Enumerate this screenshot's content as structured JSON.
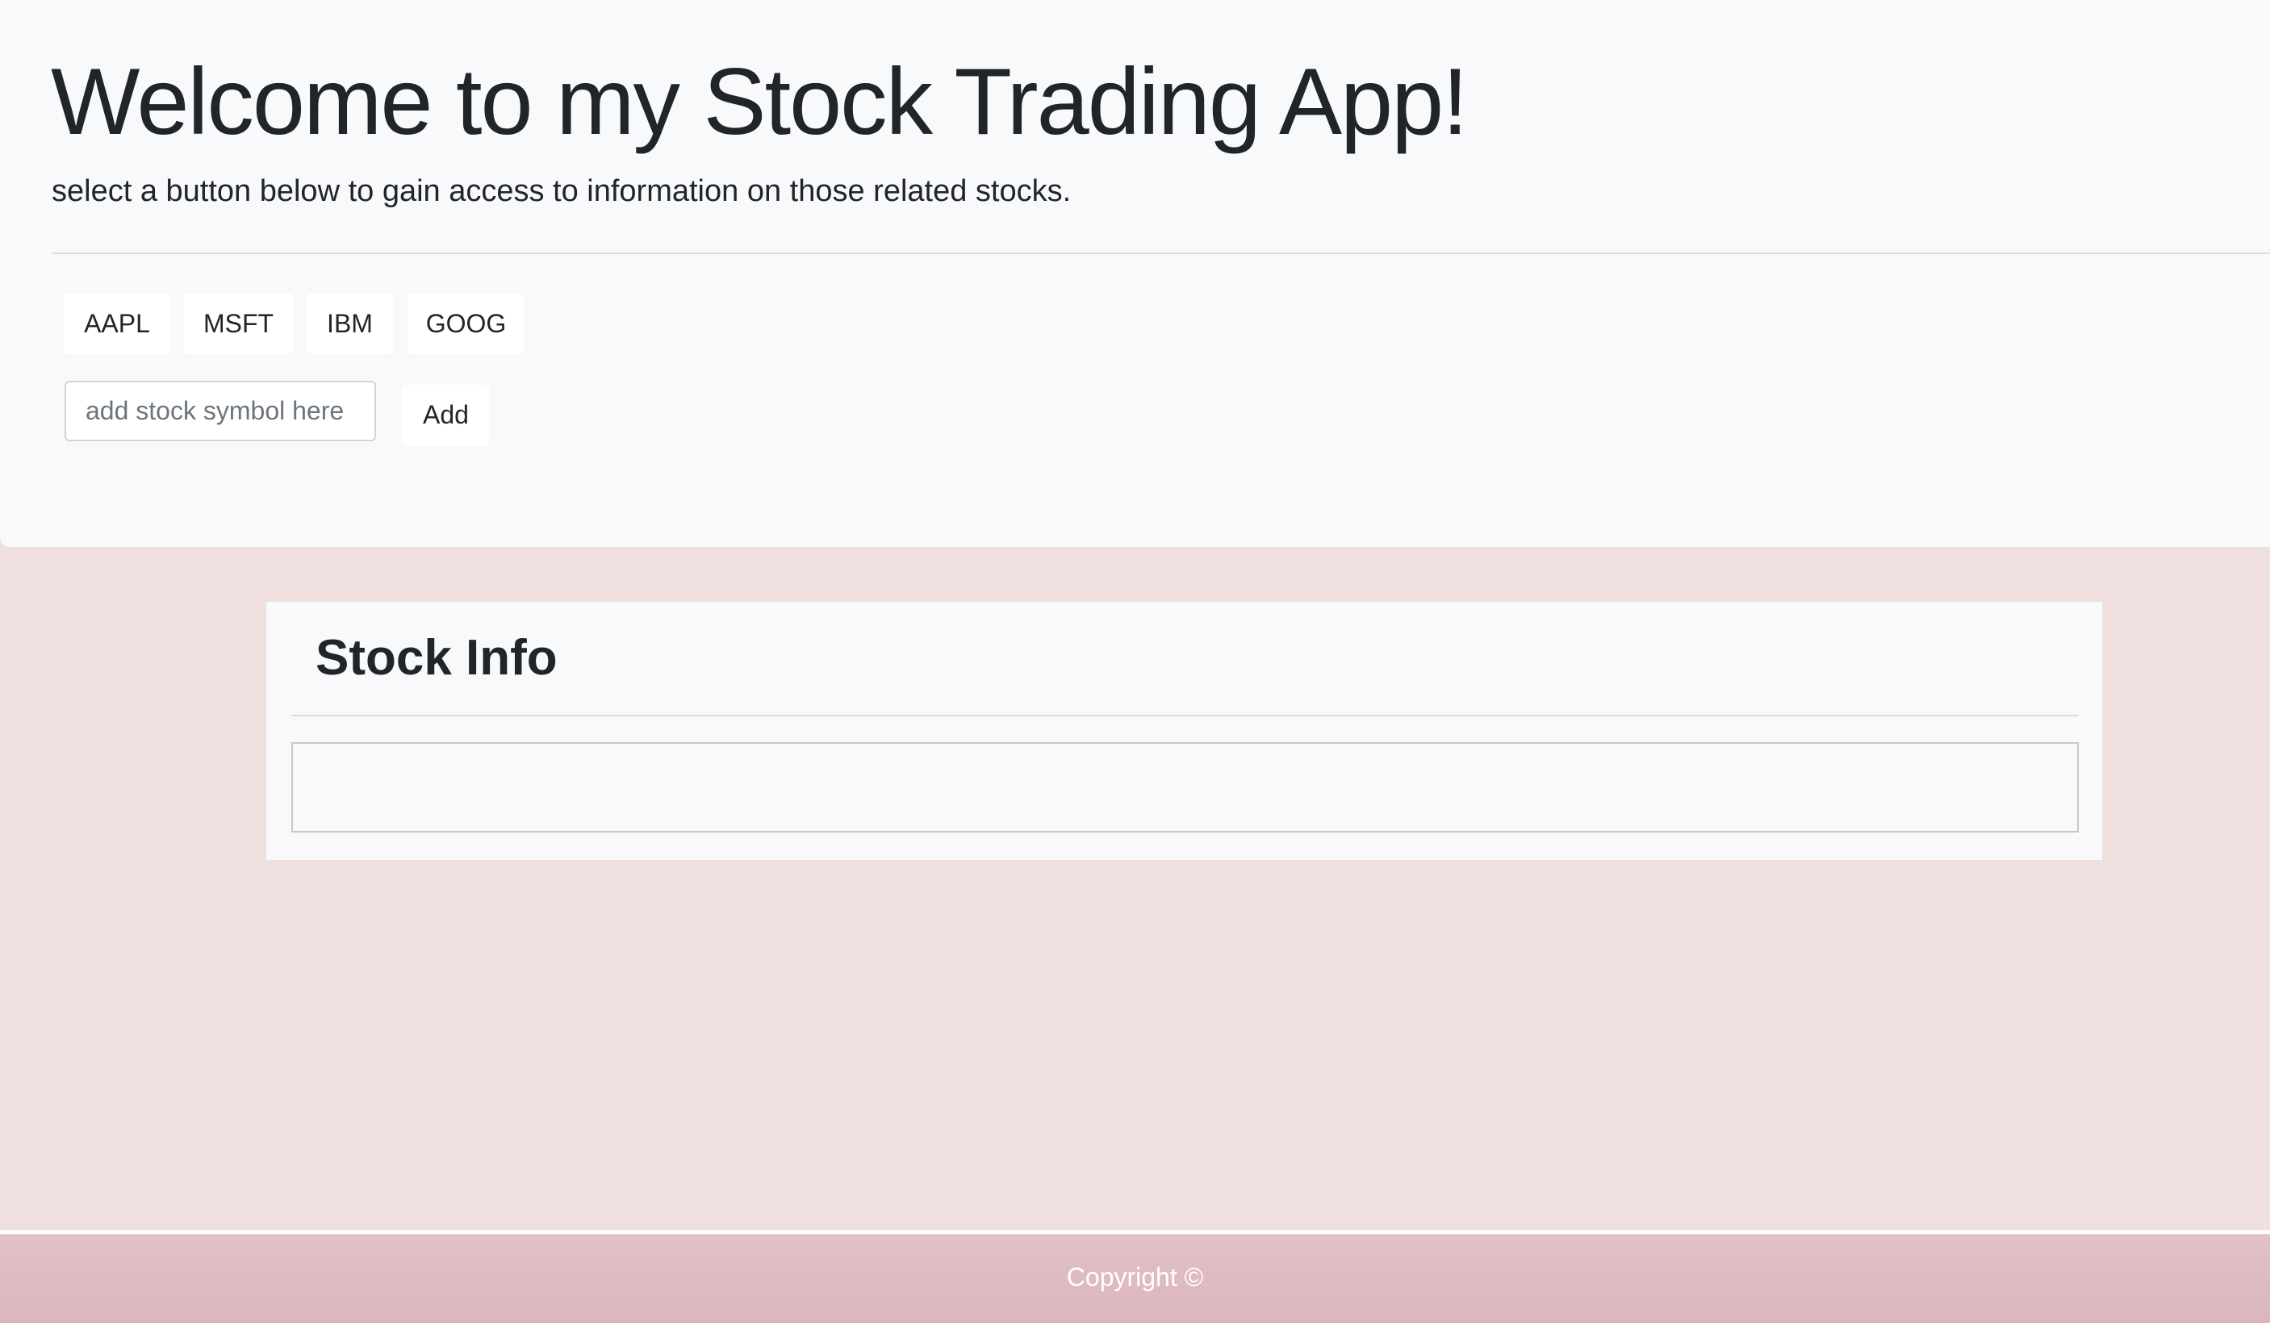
{
  "header": {
    "title": "Welcome to my Stock Trading App!",
    "subtitle": "select a button below to gain access to information on those related stocks."
  },
  "stock_buttons": [
    "AAPL",
    "MSFT",
    "IBM",
    "GOOG"
  ],
  "add_form": {
    "placeholder": "add stock symbol here",
    "value": "",
    "button_label": "Add"
  },
  "stock_info": {
    "title": "Stock Info",
    "content": ""
  },
  "footer": {
    "text": "Copyright ©"
  },
  "colors": {
    "jumbotron_bg": "#f8f9fa",
    "page_bg": "#f0dfdf",
    "footer_bg": "#dfbbc2",
    "text": "#212529"
  }
}
